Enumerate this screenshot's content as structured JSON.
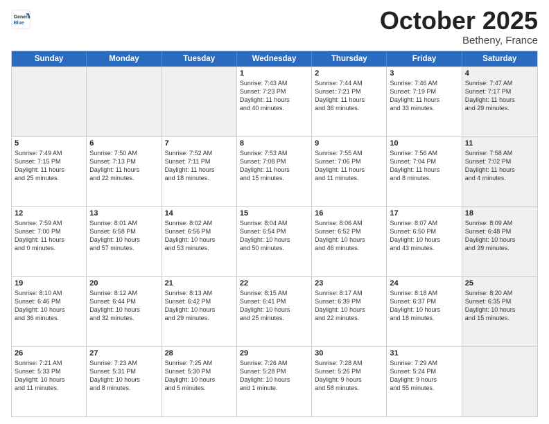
{
  "header": {
    "logo_general": "General",
    "logo_blue": "Blue",
    "month": "October 2025",
    "location": "Betheny, France"
  },
  "days_of_week": [
    "Sunday",
    "Monday",
    "Tuesday",
    "Wednesday",
    "Thursday",
    "Friday",
    "Saturday"
  ],
  "weeks": [
    [
      {
        "day": "",
        "info": "",
        "shaded": true
      },
      {
        "day": "",
        "info": "",
        "shaded": true
      },
      {
        "day": "",
        "info": "",
        "shaded": true
      },
      {
        "day": "1",
        "info": "Sunrise: 7:43 AM\nSunset: 7:23 PM\nDaylight: 11 hours\nand 40 minutes."
      },
      {
        "day": "2",
        "info": "Sunrise: 7:44 AM\nSunset: 7:21 PM\nDaylight: 11 hours\nand 36 minutes."
      },
      {
        "day": "3",
        "info": "Sunrise: 7:46 AM\nSunset: 7:19 PM\nDaylight: 11 hours\nand 33 minutes."
      },
      {
        "day": "4",
        "info": "Sunrise: 7:47 AM\nSunset: 7:17 PM\nDaylight: 11 hours\nand 29 minutes.",
        "shaded": true
      }
    ],
    [
      {
        "day": "5",
        "info": "Sunrise: 7:49 AM\nSunset: 7:15 PM\nDaylight: 11 hours\nand 25 minutes."
      },
      {
        "day": "6",
        "info": "Sunrise: 7:50 AM\nSunset: 7:13 PM\nDaylight: 11 hours\nand 22 minutes."
      },
      {
        "day": "7",
        "info": "Sunrise: 7:52 AM\nSunset: 7:11 PM\nDaylight: 11 hours\nand 18 minutes."
      },
      {
        "day": "8",
        "info": "Sunrise: 7:53 AM\nSunset: 7:08 PM\nDaylight: 11 hours\nand 15 minutes."
      },
      {
        "day": "9",
        "info": "Sunrise: 7:55 AM\nSunset: 7:06 PM\nDaylight: 11 hours\nand 11 minutes."
      },
      {
        "day": "10",
        "info": "Sunrise: 7:56 AM\nSunset: 7:04 PM\nDaylight: 11 hours\nand 8 minutes."
      },
      {
        "day": "11",
        "info": "Sunrise: 7:58 AM\nSunset: 7:02 PM\nDaylight: 11 hours\nand 4 minutes.",
        "shaded": true
      }
    ],
    [
      {
        "day": "12",
        "info": "Sunrise: 7:59 AM\nSunset: 7:00 PM\nDaylight: 11 hours\nand 0 minutes."
      },
      {
        "day": "13",
        "info": "Sunrise: 8:01 AM\nSunset: 6:58 PM\nDaylight: 10 hours\nand 57 minutes."
      },
      {
        "day": "14",
        "info": "Sunrise: 8:02 AM\nSunset: 6:56 PM\nDaylight: 10 hours\nand 53 minutes."
      },
      {
        "day": "15",
        "info": "Sunrise: 8:04 AM\nSunset: 6:54 PM\nDaylight: 10 hours\nand 50 minutes."
      },
      {
        "day": "16",
        "info": "Sunrise: 8:06 AM\nSunset: 6:52 PM\nDaylight: 10 hours\nand 46 minutes."
      },
      {
        "day": "17",
        "info": "Sunrise: 8:07 AM\nSunset: 6:50 PM\nDaylight: 10 hours\nand 43 minutes."
      },
      {
        "day": "18",
        "info": "Sunrise: 8:09 AM\nSunset: 6:48 PM\nDaylight: 10 hours\nand 39 minutes.",
        "shaded": true
      }
    ],
    [
      {
        "day": "19",
        "info": "Sunrise: 8:10 AM\nSunset: 6:46 PM\nDaylight: 10 hours\nand 36 minutes."
      },
      {
        "day": "20",
        "info": "Sunrise: 8:12 AM\nSunset: 6:44 PM\nDaylight: 10 hours\nand 32 minutes."
      },
      {
        "day": "21",
        "info": "Sunrise: 8:13 AM\nSunset: 6:42 PM\nDaylight: 10 hours\nand 29 minutes."
      },
      {
        "day": "22",
        "info": "Sunrise: 8:15 AM\nSunset: 6:41 PM\nDaylight: 10 hours\nand 25 minutes."
      },
      {
        "day": "23",
        "info": "Sunrise: 8:17 AM\nSunset: 6:39 PM\nDaylight: 10 hours\nand 22 minutes."
      },
      {
        "day": "24",
        "info": "Sunrise: 8:18 AM\nSunset: 6:37 PM\nDaylight: 10 hours\nand 18 minutes."
      },
      {
        "day": "25",
        "info": "Sunrise: 8:20 AM\nSunset: 6:35 PM\nDaylight: 10 hours\nand 15 minutes.",
        "shaded": true
      }
    ],
    [
      {
        "day": "26",
        "info": "Sunrise: 7:21 AM\nSunset: 5:33 PM\nDaylight: 10 hours\nand 11 minutes."
      },
      {
        "day": "27",
        "info": "Sunrise: 7:23 AM\nSunset: 5:31 PM\nDaylight: 10 hours\nand 8 minutes."
      },
      {
        "day": "28",
        "info": "Sunrise: 7:25 AM\nSunset: 5:30 PM\nDaylight: 10 hours\nand 5 minutes."
      },
      {
        "day": "29",
        "info": "Sunrise: 7:26 AM\nSunset: 5:28 PM\nDaylight: 10 hours\nand 1 minute."
      },
      {
        "day": "30",
        "info": "Sunrise: 7:28 AM\nSunset: 5:26 PM\nDaylight: 9 hours\nand 58 minutes."
      },
      {
        "day": "31",
        "info": "Sunrise: 7:29 AM\nSunset: 5:24 PM\nDaylight: 9 hours\nand 55 minutes."
      },
      {
        "day": "",
        "info": "",
        "shaded": true
      }
    ]
  ]
}
